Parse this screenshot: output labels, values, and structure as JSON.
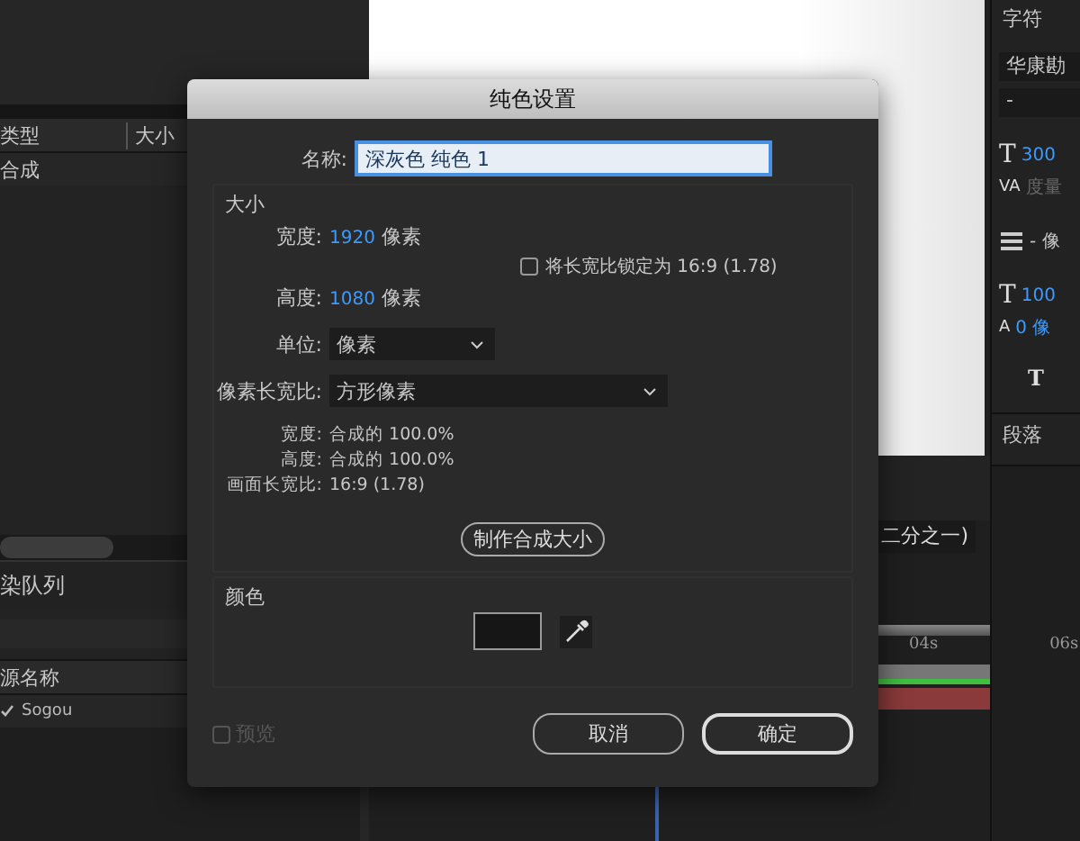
{
  "project_panel": {
    "columns": [
      "类型",
      "大小"
    ],
    "rows": [
      "合成"
    ]
  },
  "render_queue": {
    "title": "染队列",
    "columns": [
      "源名称"
    ],
    "rows": [
      {
        "checked": true,
        "name": "Sogou"
      }
    ]
  },
  "viewer": {
    "zoom_label": "二分之一)"
  },
  "timeline": {
    "ruler": [
      "04s",
      "06s"
    ]
  },
  "character_panel": {
    "title": "字符",
    "font": "华康勘",
    "style": "-",
    "size_icon": "T",
    "size": "300",
    "kerning_icon": "VA",
    "kerning": "度量",
    "vertical_scale_icon": "T",
    "baseline_icon": "A",
    "bold_icon": "T",
    "stroke": "- 像",
    "vertical_scale": "100",
    "baseline_shift": "0 像",
    "paragraph_title": "段落"
  },
  "dialog": {
    "title": "纯色设置",
    "name_label": "名称:",
    "name_value": "深灰色 纯色 1",
    "size_section": "大小",
    "width_label": "宽度:",
    "width_value": "1920",
    "width_unit": "像素",
    "height_label": "高度:",
    "height_value": "1080",
    "height_unit": "像素",
    "lock_label": "将长宽比锁定为 16:9 (1.78)",
    "lock_checked": false,
    "units_label": "单位:",
    "units_value": "像素",
    "par_label": "像素长宽比:",
    "par_value": "方形像素",
    "info": [
      {
        "label": "宽度:",
        "value": "合成的 100.0%"
      },
      {
        "label": "高度:",
        "value": "合成的 100.0%"
      },
      {
        "label": "画面长宽比:",
        "value": "16:9 (1.78)"
      }
    ],
    "make_comp_size": "制作合成大小",
    "color_section": "颜色",
    "color": "#161616",
    "preview_label": "预览",
    "preview_checked": false,
    "buttons": [
      "取消",
      "确定"
    ]
  }
}
